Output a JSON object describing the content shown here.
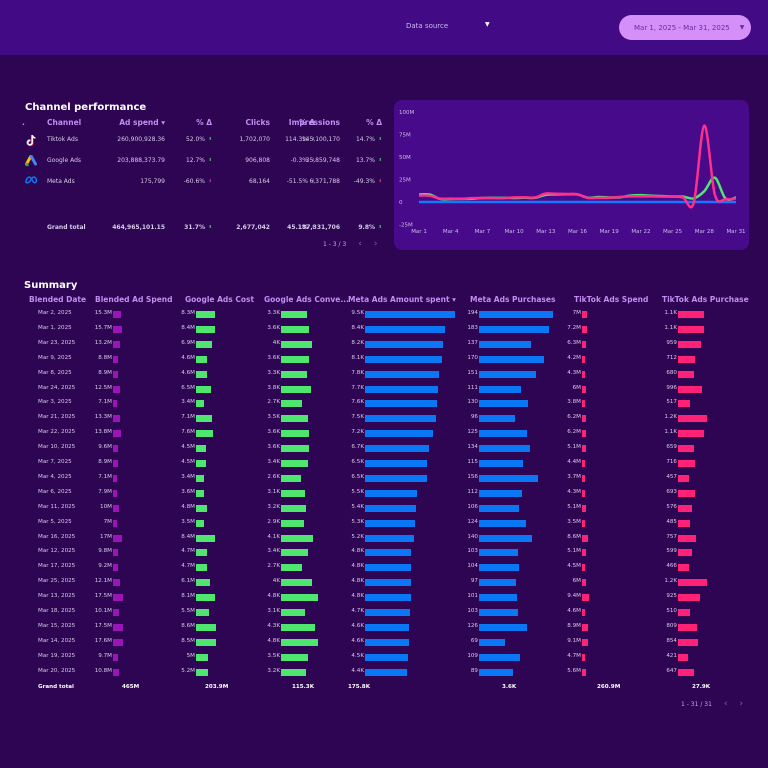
{
  "header": {
    "data_source_label": "Data source",
    "date_range": "Mar 1, 2025 - Mar 31, 2025"
  },
  "channel": {
    "title": "Channel performance",
    "columns": [
      ".",
      "Channel",
      "Ad spend ▾",
      "% Δ",
      "Clicks",
      "% Δ",
      "Impressions",
      "% Δ"
    ],
    "rows": [
      {
        "icon": "tiktok-logo-icon",
        "name": "Tiktok Ads",
        "spend": "260,900,928.36",
        "spend_d": "52.0%",
        "spend_up": true,
        "clicks": "1,702,070",
        "clicks_d": "114.3%",
        "clicks_up": true,
        "impr": "145,100,170",
        "impr_d": "14.7%",
        "impr_up": true
      },
      {
        "icon": "google-ads-logo-icon",
        "name": "Google Ads",
        "spend": "203,888,373.79",
        "spend_d": "12.7%",
        "spend_up": true,
        "clicks": "906,808",
        "clicks_d": "-0.3%",
        "clicks_up": false,
        "impr": "35,859,748",
        "impr_d": "13.7%",
        "impr_up": true
      },
      {
        "icon": "meta-logo-icon",
        "name": "Meta Ads",
        "spend": "175,799",
        "spend_d": "-60.6%",
        "spend_up": false,
        "clicks": "68,164",
        "clicks_d": "-51.5%",
        "clicks_up": false,
        "impr": "6,371,788",
        "impr_d": "-49.3%",
        "impr_up": false
      }
    ],
    "total": {
      "name": "Grand total",
      "spend": "464,965,101.15",
      "spend_d": "31.7%",
      "clicks": "2,677,042",
      "clicks_d": "45.1%",
      "impr": "187,331,706",
      "impr_d": "9.8%"
    },
    "pager": "1 - 3 / 3"
  },
  "chart_data": {
    "type": "line",
    "y_ticks": [
      "100M",
      "75M",
      "50M",
      "25M",
      "0",
      "-25M"
    ],
    "ylim": [
      -25,
      100
    ],
    "x_ticks": [
      "Mar 1",
      "Mar 4",
      "Mar 7",
      "Mar 10",
      "Mar 13",
      "Mar 16",
      "Mar 19",
      "Mar 22",
      "Mar 25",
      "Mar 28",
      "Mar 31"
    ],
    "x": [
      1,
      2,
      3,
      4,
      5,
      6,
      7,
      8,
      9,
      10,
      11,
      12,
      13,
      14,
      15,
      16,
      17,
      18,
      19,
      20,
      21,
      22,
      23,
      24,
      25,
      26,
      27,
      28,
      29,
      30,
      31
    ],
    "series": [
      {
        "color": "#ff2f8e",
        "values": [
          7.2,
          7,
          3.8,
          3.7,
          3.5,
          4.3,
          4.4,
          4.3,
          4.2,
          5.1,
          5.1,
          5.1,
          9.4,
          9.1,
          8.9,
          8.6,
          4.5,
          4.6,
          4.7,
          5.6,
          6.2,
          6.2,
          6.3,
          6,
          6,
          5,
          -1,
          85,
          8,
          3,
          4
        ]
      },
      {
        "color": "#4ee66e",
        "values": [
          8.4,
          8.3,
          3.4,
          3.4,
          3.5,
          3.6,
          4.5,
          4.6,
          4.6,
          4.5,
          4.8,
          4.7,
          8.1,
          8.5,
          8.6,
          8.4,
          4.7,
          5.5,
          5,
          5.2,
          7.1,
          7.6,
          6.9,
          6.5,
          6.1,
          6,
          4,
          12,
          27,
          4,
          5
        ]
      },
      {
        "color": "#1677ff",
        "values": [
          0,
          0,
          0,
          0,
          0,
          0,
          0,
          0,
          0,
          0,
          0,
          0,
          0,
          0,
          0,
          0,
          0,
          0,
          0,
          0,
          0,
          0,
          0,
          0,
          0,
          0,
          0,
          0,
          0,
          0,
          0
        ]
      }
    ]
  },
  "summary": {
    "title": "Summary",
    "columns": [
      "Blended Date",
      "Blended Ad Spend",
      "Google Ads Cost",
      "Google Ads Conve...",
      "Meta Ads Amount spent ▾",
      "Meta Ads Purchases",
      "TikTok Ads Spend",
      "TikTok Ads Purchase"
    ],
    "colors": {
      "blended": "#9b14b8",
      "google": "#4ee66e",
      "meta": "#0a78f5",
      "tiktok": "#ff2277"
    },
    "rows": [
      [
        "Mar 2, 2025",
        "15.3M",
        "8.3M",
        "3.3K",
        "9.5K",
        "194",
        "7M",
        "1.1K"
      ],
      [
        "Mar 1, 2025",
        "15.7M",
        "8.4M",
        "3.6K",
        "8.4K",
        "183",
        "7.2M",
        "1.1K"
      ],
      [
        "Mar 23, 2025",
        "13.2M",
        "6.9M",
        "4K",
        "8.2K",
        "137",
        "6.3M",
        "959"
      ],
      [
        "Mar 9, 2025",
        "8.8M",
        "4.6M",
        "3.6K",
        "8.1K",
        "170",
        "4.2M",
        "712"
      ],
      [
        "Mar 8, 2025",
        "8.9M",
        "4.6M",
        "3.3K",
        "7.8K",
        "151",
        "4.3M",
        "680"
      ],
      [
        "Mar 24, 2025",
        "12.5M",
        "6.5M",
        "3.8K",
        "7.7K",
        "111",
        "6M",
        "996"
      ],
      [
        "Mar 3, 2025",
        "7.1M",
        "3.4M",
        "2.7K",
        "7.6K",
        "130",
        "3.8M",
        "517"
      ],
      [
        "Mar 21, 2025",
        "13.3M",
        "7.1M",
        "3.5K",
        "7.5K",
        "96",
        "6.2M",
        "1.2K"
      ],
      [
        "Mar 22, 2025",
        "13.8M",
        "7.6M",
        "3.6K",
        "7.2K",
        "125",
        "6.2M",
        "1.1K"
      ],
      [
        "Mar 10, 2025",
        "9.6M",
        "4.5M",
        "3.6K",
        "6.7K",
        "134",
        "5.1M",
        "659"
      ],
      [
        "Mar 7, 2025",
        "8.9M",
        "4.5M",
        "3.4K",
        "6.5K",
        "115",
        "4.4M",
        "716"
      ],
      [
        "Mar 4, 2025",
        "7.1M",
        "3.4M",
        "2.6K",
        "6.5K",
        "156",
        "3.7M",
        "457"
      ],
      [
        "Mar 6, 2025",
        "7.9M",
        "3.6M",
        "3.1K",
        "5.5K",
        "112",
        "4.3M",
        "693"
      ],
      [
        "Mar 11, 2025",
        "10M",
        "4.8M",
        "3.2K",
        "5.4K",
        "106",
        "5.1M",
        "576"
      ],
      [
        "Mar 5, 2025",
        "7M",
        "3.5M",
        "2.9K",
        "5.3K",
        "124",
        "3.5M",
        "485"
      ],
      [
        "Mar 16, 2025",
        "17M",
        "8.4M",
        "4.1K",
        "5.2K",
        "140",
        "8.6M",
        "757"
      ],
      [
        "Mar 12, 2025",
        "9.8M",
        "4.7M",
        "3.4K",
        "4.8K",
        "103",
        "5.1M",
        "599"
      ],
      [
        "Mar 17, 2025",
        "9.2M",
        "4.7M",
        "2.7K",
        "4.8K",
        "104",
        "4.5M",
        "466"
      ],
      [
        "Mar 25, 2025",
        "12.1M",
        "6.1M",
        "4K",
        "4.8K",
        "97",
        "6M",
        "1.2K"
      ],
      [
        "Mar 13, 2025",
        "17.5M",
        "8.1M",
        "4.8K",
        "4.8K",
        "101",
        "9.4M",
        "925"
      ],
      [
        "Mar 18, 2025",
        "10.1M",
        "5.5M",
        "3.1K",
        "4.7K",
        "103",
        "4.6M",
        "510"
      ],
      [
        "Mar 15, 2025",
        "17.5M",
        "8.6M",
        "4.3K",
        "4.6K",
        "126",
        "8.9M",
        "809"
      ],
      [
        "Mar 14, 2025",
        "17.6M",
        "8.5M",
        "4.8K",
        "4.6K",
        "69",
        "9.1M",
        "854"
      ],
      [
        "Mar 19, 2025",
        "9.7M",
        "5M",
        "3.5K",
        "4.5K",
        "109",
        "4.7M",
        "421"
      ],
      [
        "Mar 20, 2025",
        "10.8M",
        "5.2M",
        "3.2K",
        "4.4K",
        "89",
        "5.6M",
        "647"
      ]
    ],
    "total": [
      "Grand total",
      "465M",
      "203.9M",
      "115.3K",
      "175.8K",
      "3.6K",
      "260.9M",
      "27.9K"
    ],
    "pager": "1 - 31 / 31"
  }
}
